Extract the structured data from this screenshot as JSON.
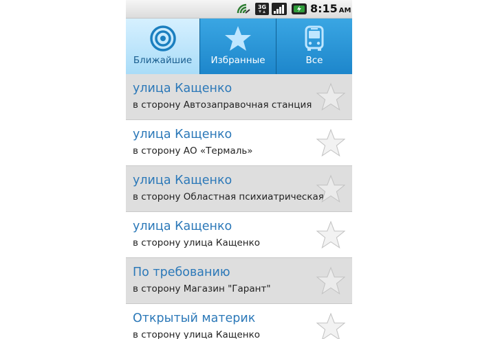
{
  "statusbar": {
    "network": "3G",
    "time": "8:15",
    "ampm": "AM",
    "icons": [
      "sync-icon",
      "3g-data-icon",
      "signal-icon",
      "battery-icon"
    ]
  },
  "tabs": [
    {
      "label": "Ближайшие",
      "icon": "target-icon",
      "active": true
    },
    {
      "label": "Избранные",
      "icon": "star-icon",
      "active": false
    },
    {
      "label": "Все",
      "icon": "bus-icon",
      "active": false
    }
  ],
  "stops": [
    {
      "title": "улица Кащенко",
      "direction": "в сторону Автозаправочная станция",
      "favorite": false
    },
    {
      "title": "улица Кащенко",
      "direction": "в сторону АО «Термаль»",
      "favorite": false
    },
    {
      "title": "улица Кащенко",
      "direction": "в сторону Областная психиатрическая",
      "favorite": false
    },
    {
      "title": "улица Кащенко",
      "direction": "в сторону улица Кащенко",
      "favorite": false
    },
    {
      "title": "По требованию",
      "direction": "в сторону Магазин \"Гарант\"",
      "favorite": false
    },
    {
      "title": "Открытый материк",
      "direction": "в сторону улица Кащенко",
      "favorite": false
    }
  ],
  "colors": {
    "tab_bg": "#1d86cb",
    "tab_active_bg": "#c2e8fc",
    "title_text": "#2b78b8",
    "row_alt_bg": "#dedede"
  }
}
